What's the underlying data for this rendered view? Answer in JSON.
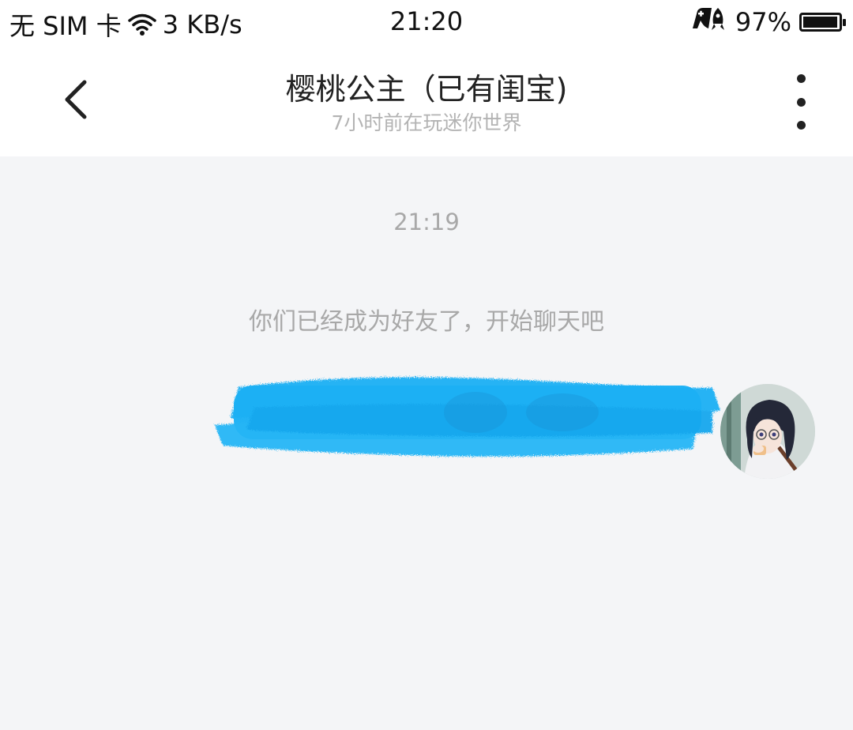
{
  "status_bar": {
    "carrier": "无 SIM 卡",
    "net_speed": "3 KB/s",
    "time": "21:20",
    "battery_text": "97%",
    "battery_level": 0.97
  },
  "header": {
    "title": "樱桃公主（已有闺宝)",
    "subtitle": "7小时前在玩迷你世界"
  },
  "messages": {
    "timestamp": "21:19",
    "system_notice": "你们已经成为好友了，开始聊天吧"
  },
  "colors": {
    "bubble": "#22b3f5",
    "background": "#f4f5f7"
  }
}
